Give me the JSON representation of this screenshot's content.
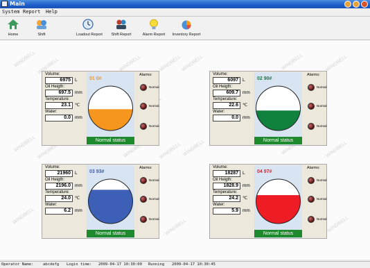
{
  "window": {
    "title": "Main"
  },
  "menu": [
    {
      "label": "System"
    },
    {
      "label": "Report"
    },
    {
      "label": "Help"
    }
  ],
  "toolbar": [
    {
      "label": "Home",
      "icon": "home-icon"
    },
    {
      "label": "Shift",
      "icon": "shift-icon"
    },
    {
      "label": "Loadout Report",
      "icon": "clock-icon"
    },
    {
      "label": "Shift Report",
      "icon": "team-icon"
    },
    {
      "label": "Alarm Report",
      "icon": "bulb-icon"
    },
    {
      "label": "Inventory Report",
      "icon": "inventory-icon"
    }
  ],
  "watermark": "WINDBELL",
  "labels": {
    "volume": "Volume:",
    "oil_height": "Oil Heigth:",
    "temperature": "Temperature:",
    "water": "Water:",
    "alarms": "Alarms:",
    "unit_volume": "L",
    "unit_height": "mm",
    "unit_temp": "℃",
    "unit_water": "mm"
  },
  "tanks": [
    {
      "id": "01",
      "oil": "0#",
      "volume": "6975",
      "oil_height": "697.5",
      "temperature": "23.1",
      "water": "0.0",
      "status": "Normal status",
      "fill_fraction": 0.48,
      "color": "#f7961e",
      "label_color": "#f7961e",
      "alarms": [
        "Normal",
        "Normal",
        "Normal"
      ]
    },
    {
      "id": "02",
      "oil": "90#",
      "volume": "6097",
      "oil_height": "609.7",
      "temperature": "22.6",
      "water": "0.0",
      "status": "Normal status",
      "fill_fraction": 0.45,
      "color": "#11823d",
      "label_color": "#11823d",
      "alarms": [
        "Normal",
        "Normal",
        "Normal"
      ]
    },
    {
      "id": "03",
      "oil": "93#",
      "volume": "21960",
      "oil_height": "2196.0",
      "temperature": "24.0",
      "water": "6.2",
      "status": "Normal status",
      "fill_fraction": 0.76,
      "color": "#3d5fb6",
      "label_color": "#3d5fb6",
      "alarms": [
        "Normal",
        "Normal",
        "Normal"
      ]
    },
    {
      "id": "04",
      "oil": "97#",
      "volume": "18287",
      "oil_height": "1828.9",
      "temperature": "24.2",
      "water": "5.9",
      "status": "Normal status",
      "fill_fraction": 0.64,
      "color": "#ee1c24",
      "label_color": "#ee1c24",
      "alarms": [
        "Normal",
        "Normal",
        "Normal"
      ]
    }
  ],
  "statusbar": {
    "operator_label": "Operator Name:",
    "operator": "abcdefg",
    "login_label": "Login time:",
    "login_time": "2009-04-17 10:30:00",
    "running_label": "Running",
    "running_time": "2009-04-17 10:30:45"
  }
}
